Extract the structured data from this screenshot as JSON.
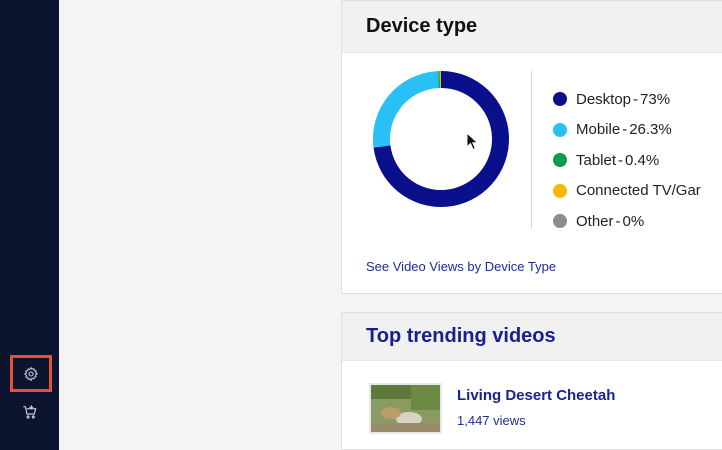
{
  "sidebar": {
    "settings_icon": "gear-icon",
    "cart_icon": "cart-icon",
    "highlight_color": "#e8503a"
  },
  "device_card": {
    "title": "Device type",
    "legend": [
      {
        "label": "Desktop",
        "separator": "-",
        "value": "73%",
        "percent": 73,
        "color": "#0a0f8c"
      },
      {
        "label": "Mobile",
        "separator": "-",
        "value": "26.3%",
        "percent": 26.3,
        "color": "#29c0f5"
      },
      {
        "label": "Tablet",
        "separator": "-",
        "value": "0.4%",
        "percent": 0.4,
        "color": "#0a9e4a"
      },
      {
        "label": "Connected TV/Gar",
        "separator": "",
        "value": "",
        "percent": 0.3,
        "color": "#f8b800"
      },
      {
        "label": "Other",
        "separator": "-",
        "value": "0%",
        "percent": 0,
        "color": "#8c8c8c"
      }
    ],
    "link": "See Video Views by Device Type"
  },
  "trending_card": {
    "title": "Top trending videos",
    "video": {
      "title": "Living Desert Cheetah",
      "views": "1,447 views"
    }
  }
}
